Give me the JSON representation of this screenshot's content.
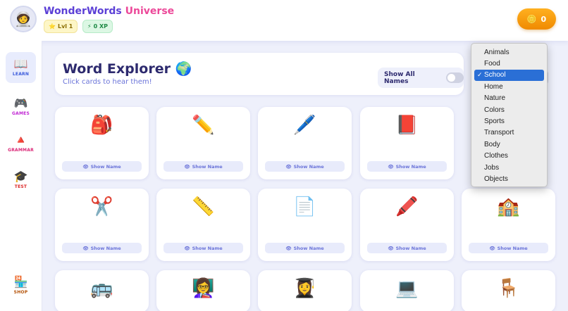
{
  "header": {
    "avatar": "🧑‍🚀",
    "brand_part1": "WonderWords",
    "brand_part2": "Universe",
    "level": "Lvl 1",
    "xp": "0 XP",
    "coins": "0"
  },
  "sidebar": {
    "items": [
      {
        "label": "LEARN",
        "icon": "📖"
      },
      {
        "label": "GAMES",
        "icon": "🎮"
      },
      {
        "label": "GRAMMAR",
        "icon": "🔺"
      },
      {
        "label": "TEST",
        "icon": "🎓"
      },
      {
        "label": "SHOP",
        "icon": "🏪"
      }
    ]
  },
  "main": {
    "title": "Word Explorer 🌍",
    "subtitle": "Click cards to hear them!",
    "show_all_label": "Show All Names",
    "show_name_label": "Show Name",
    "cards": [
      {
        "emoji": "🎒"
      },
      {
        "emoji": "✏️"
      },
      {
        "emoji": "🖊️"
      },
      {
        "emoji": "📕"
      },
      {
        "emoji": "✂️"
      },
      {
        "emoji": "📏"
      },
      {
        "emoji": "📄"
      },
      {
        "emoji": "🖍️"
      },
      {
        "emoji": "🏫"
      },
      {
        "emoji": "🚌"
      },
      {
        "emoji": "👩‍🏫"
      },
      {
        "emoji": "👩‍🎓"
      },
      {
        "emoji": "💻"
      },
      {
        "emoji": "🪑"
      }
    ]
  },
  "category_dropdown": {
    "selected": "School",
    "options": [
      "Animals",
      "Food",
      "School",
      "Home",
      "Nature",
      "Colors",
      "Sports",
      "Transport",
      "Body",
      "Clothes",
      "Jobs",
      "Objects"
    ]
  }
}
